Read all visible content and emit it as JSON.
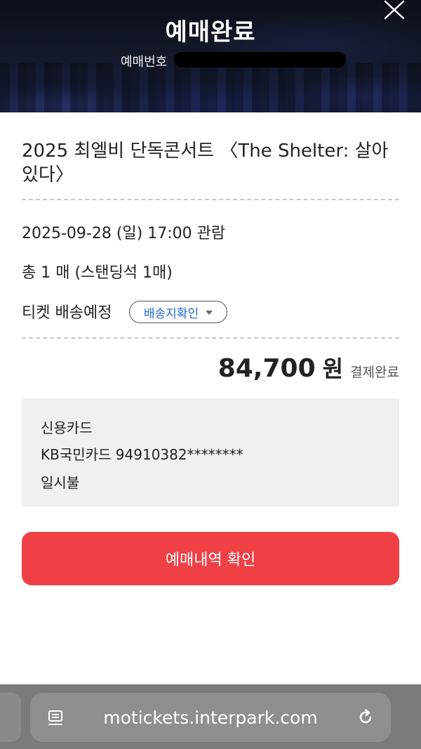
{
  "header": {
    "title": "예매완료",
    "booking_number_label": "예매번호"
  },
  "event": {
    "title": "2025 최엘비 단독콘서트 〈The Shelter: 살아있다〉"
  },
  "details": {
    "datetime": "2025-09-28 (일) 17:00 관람",
    "ticket_count": "총 1 매 (스탠딩석 1매)",
    "delivery_label": "티켓 배송예정",
    "delivery_button": "배송지확인"
  },
  "payment": {
    "amount": "84,700",
    "currency": "원",
    "status": "결제완료",
    "method": "신용카드",
    "card": "KB국민카드 94910382********",
    "installment": "일시불"
  },
  "cta": {
    "label": "예매내역 확인"
  },
  "browser": {
    "url": "motickets.interpark.com"
  },
  "icons": {
    "close": "close-icon",
    "dropdown": "caret-down-icon",
    "reader": "reader-icon",
    "reload": "reload-icon"
  },
  "colors": {
    "accent": "#ef4046",
    "link": "#1e68d6"
  }
}
